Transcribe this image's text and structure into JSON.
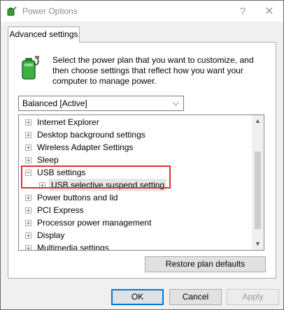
{
  "window": {
    "title": "Power Options",
    "help_glyph": "?",
    "close_glyph": "✕"
  },
  "tab": {
    "label": "Advanced settings"
  },
  "description": "Select the power plan that you want to customize, and then choose settings that reflect how you want your computer to manage power.",
  "plan_select": {
    "value": "Balanced [Active]",
    "arrow": "⌵"
  },
  "tree": {
    "items": [
      {
        "label": "Internet Explorer",
        "expander": "+"
      },
      {
        "label": "Desktop background settings",
        "expander": "+"
      },
      {
        "label": "Wireless Adapter Settings",
        "expander": "+"
      },
      {
        "label": "Sleep",
        "expander": "+"
      },
      {
        "label": "USB settings",
        "expander": "−"
      },
      {
        "label": "USB selective suspend setting",
        "expander": "+"
      },
      {
        "label": "Power buttons and lid",
        "expander": "+"
      },
      {
        "label": "PCI Express",
        "expander": "+"
      },
      {
        "label": "Processor power management",
        "expander": "+"
      },
      {
        "label": "Display",
        "expander": "+"
      },
      {
        "label": "Multimedia settings",
        "expander": "+"
      }
    ],
    "scroll_up": "▲",
    "scroll_down": "▼"
  },
  "buttons": {
    "restore": "Restore plan defaults",
    "ok": "OK",
    "cancel": "Cancel",
    "apply": "Apply"
  },
  "colors": {
    "highlight_border": "#e2302f",
    "ok_border": "#0078d7"
  }
}
